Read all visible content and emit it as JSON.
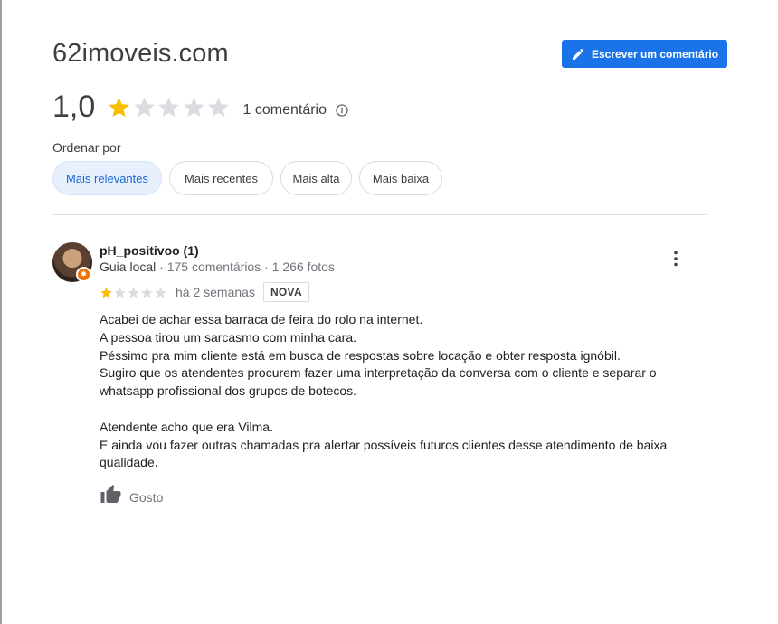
{
  "header": {
    "title": "62imoveis.com",
    "write_review_label": "Escrever um comentário"
  },
  "rating": {
    "value": "1,0",
    "stars_filled": 1,
    "stars_total": 5,
    "count_label": "1 comentário",
    "star_color": "#fbbc04",
    "empty_star_color": "#dadce0"
  },
  "sort": {
    "label": "Ordenar por",
    "chips": [
      {
        "label": "Mais relevantes",
        "active": true
      },
      {
        "label": "Mais recentes",
        "active": false
      },
      {
        "label": "Mais alta",
        "active": false
      },
      {
        "label": "Mais baixa",
        "active": false
      }
    ]
  },
  "review": {
    "author": "pH_positivoo (1)",
    "guide_label": "Guia local",
    "reviews_count": "175 comentários",
    "photos_count": "1 266 fotos",
    "separator": "·",
    "stars": 1,
    "when": "há 2 semanas",
    "badge": "NOVA",
    "lines": [
      "Acabei de achar essa barraca de feira do rolo na internet.",
      "A pessoa tirou um sarcasmo com minha cara.",
      "Péssimo pra mim cliente está em busca de respostas sobre locação e obter resposta ignóbil.",
      "Sugiro que os atendentes procurem fazer uma interpretação da conversa com o cliente e separar o whatsapp profissional dos grupos de botecos.",
      "",
      "Atendente acho que era Vilma.",
      "E ainda vou fazer outras chamadas pra alertar possíveis futuros clientes desse atendimento de baixa qualidade."
    ],
    "like_label": "Gosto"
  },
  "colors": {
    "accent": "#1a73e8",
    "chip_active_bg": "#e8f0fe",
    "chip_active_text": "#1967d2",
    "local_guide_badge": "#e8710a"
  },
  "icons": {
    "pencil": "pencil-icon",
    "info": "info-icon",
    "more": "more-vert-icon",
    "thumb": "thumb-up-icon",
    "star": "star-icon"
  }
}
